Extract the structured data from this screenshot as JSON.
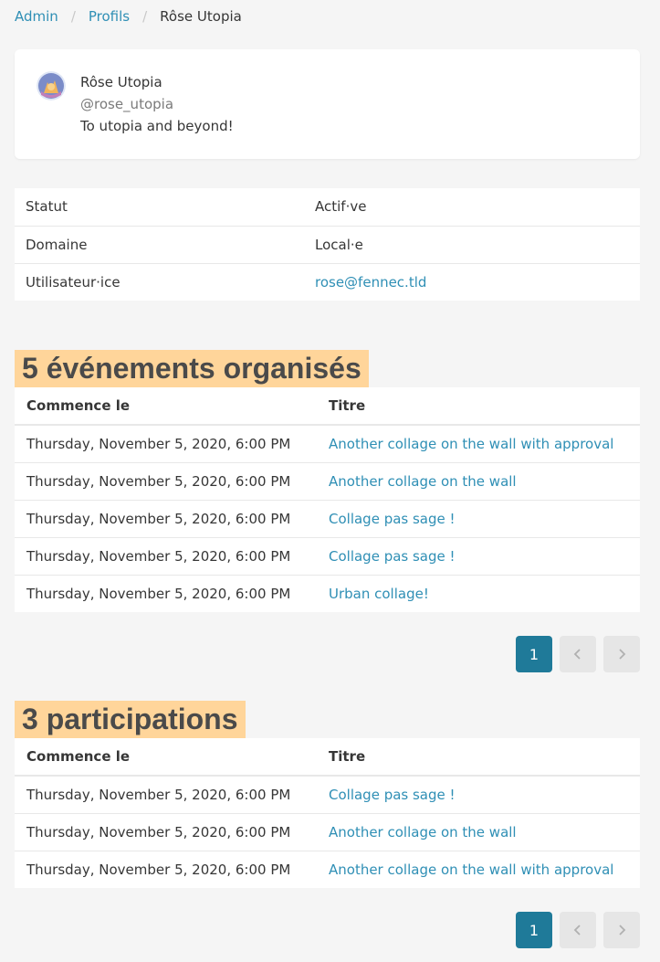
{
  "breadcrumb": {
    "items": [
      "Admin",
      "Profils"
    ],
    "current": "Rôse Utopia"
  },
  "profile": {
    "name": "Rôse Utopia",
    "handle": "@rose_utopia",
    "bio": "To utopia and beyond!"
  },
  "info": [
    {
      "label": "Statut",
      "value": "Actif·ve"
    },
    {
      "label": "Domaine",
      "value": "Local·e"
    },
    {
      "label": "Utilisateur·ice",
      "value": "rose@fennec.tld"
    }
  ],
  "organized": {
    "title": "5 événements organisés",
    "headers": [
      "Commence le",
      "Titre"
    ],
    "rows": [
      {
        "date": "Thursday, November 5, 2020, 6:00 PM",
        "title": "Another collage on the wall with approval"
      },
      {
        "date": "Thursday, November 5, 2020, 6:00 PM",
        "title": "Another collage on the wall"
      },
      {
        "date": "Thursday, November 5, 2020, 6:00 PM",
        "title": "Collage pas sage !"
      },
      {
        "date": "Thursday, November 5, 2020, 6:00 PM",
        "title": "Collage pas sage !"
      },
      {
        "date": "Thursday, November 5, 2020, 6:00 PM",
        "title": "Urban collage!"
      }
    ],
    "page": "1"
  },
  "participations": {
    "title": "3 participations",
    "headers": [
      "Commence le",
      "Titre"
    ],
    "rows": [
      {
        "date": "Thursday, November 5, 2020, 6:00 PM",
        "title": "Collage pas sage !"
      },
      {
        "date": "Thursday, November 5, 2020, 6:00 PM",
        "title": "Another collage on the wall"
      },
      {
        "date": "Thursday, November 5, 2020, 6:00 PM",
        "title": "Another collage on the wall with approval"
      }
    ],
    "page": "1"
  },
  "icons": {
    "prev": "chevron-left-icon",
    "next": "chevron-right-icon"
  },
  "colors": {
    "link": "#2f8fb5",
    "highlight": "#ffd59a",
    "page_current": "#1f7a99"
  }
}
